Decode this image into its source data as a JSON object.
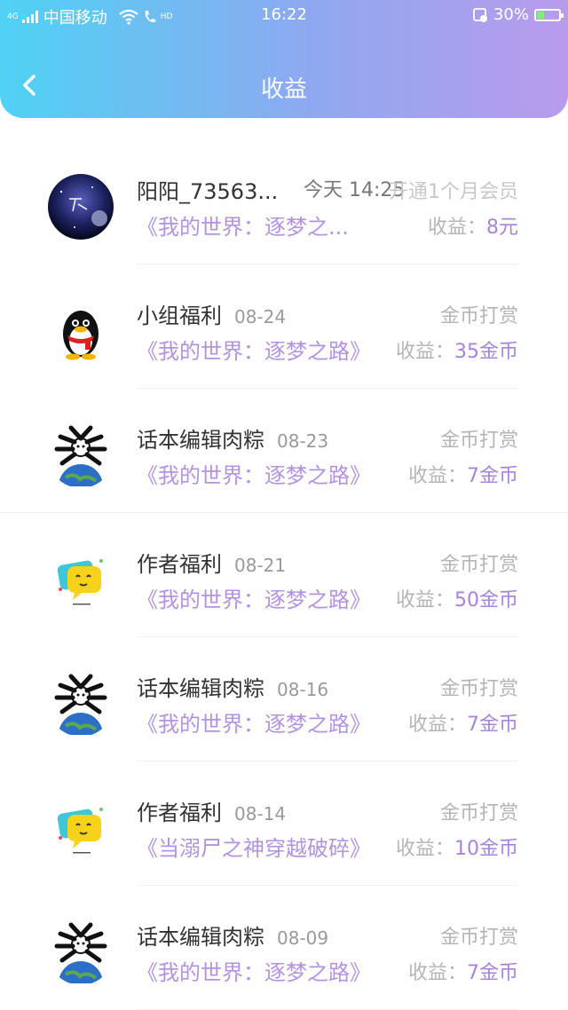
{
  "status_bar": {
    "network_tag": "4G",
    "carrier": "中国移动",
    "hd_tag": "HD",
    "time": "16:22",
    "battery": "30%"
  },
  "header": {
    "title": "收益"
  },
  "items": [
    {
      "name": "阳阳_73563...",
      "date": "今天 14:25",
      "type": "开通1个月会员",
      "book": "《我的世界：逐梦之...",
      "income_label": "收益：",
      "income_value": "8元",
      "avatar": "space-avatar"
    },
    {
      "name": "小组福利",
      "date": "08-24",
      "type": "金币打赏",
      "book": "《我的世界：逐梦之路》",
      "income_label": "收益：",
      "income_value": "35金币",
      "avatar": "qq-penguin-avatar"
    },
    {
      "name": "话本编辑肉粽",
      "date": "08-23",
      "type": "金币打赏",
      "book": "《我的世界：逐梦之路》",
      "income_label": "收益：",
      "income_value": "7金币",
      "avatar": "earth-avatar"
    },
    {
      "name": "作者福利",
      "date": "08-21",
      "type": "金币打赏",
      "book": "《我的世界：逐梦之路》",
      "income_label": "收益：",
      "income_value": "50金币",
      "avatar": "chat-bubble-avatar"
    },
    {
      "name": "话本编辑肉粽",
      "date": "08-16",
      "type": "金币打赏",
      "book": "《我的世界：逐梦之路》",
      "income_label": "收益：",
      "income_value": "7金币",
      "avatar": "earth-avatar"
    },
    {
      "name": "作者福利",
      "date": "08-14",
      "type": "金币打赏",
      "book": "《当溺尸之神穿越破碎》",
      "income_label": "收益：",
      "income_value": "10金币",
      "avatar": "chat-bubble-avatar"
    },
    {
      "name": "话本编辑肉粽",
      "date": "08-09",
      "type": "金币打赏",
      "book": "《我的世界：逐梦之路》",
      "income_label": "收益：",
      "income_value": "7金币",
      "avatar": "earth-avatar"
    }
  ]
}
